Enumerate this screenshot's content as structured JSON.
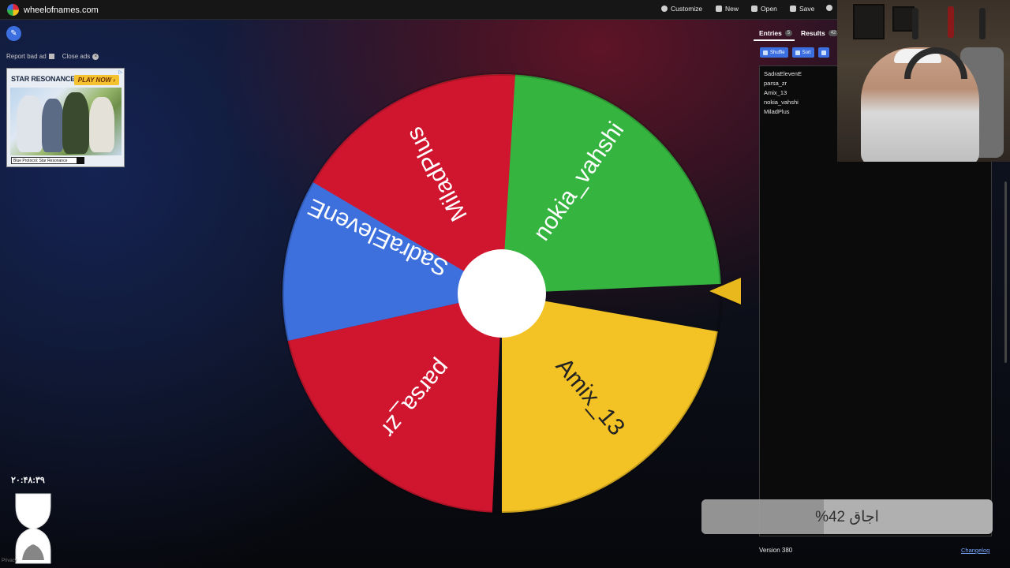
{
  "app": {
    "site_name": "wheelofnames.com",
    "menu": [
      {
        "id": "customize",
        "label": "Customize",
        "icon": "palette-icon"
      },
      {
        "id": "new",
        "label": "New",
        "icon": "file-icon"
      },
      {
        "id": "open",
        "label": "Open",
        "icon": "folder-icon"
      },
      {
        "id": "save",
        "label": "Save",
        "icon": "save-icon"
      }
    ],
    "share_icon": "share-icon"
  },
  "ads": {
    "report_label": "Report bad ad",
    "close_label": "Close ads",
    "banner": {
      "title": "STAR RESONANCE",
      "cta": "PLAY NOW ›",
      "caption": "Blue Protocol: Star Resonance"
    }
  },
  "wheel": {
    "segments": [
      {
        "label": "SadraElevenE",
        "color": "#3e70dd"
      },
      {
        "label": "parsa_zr",
        "color": "#d0162f"
      },
      {
        "label": "Amix_13",
        "color": "#f3c224"
      },
      {
        "label": "nokia_vahshi",
        "color": "#35b440"
      },
      {
        "label": "MiladPlus",
        "color": "#d0162f"
      }
    ],
    "pointer_color": "#e8b81c"
  },
  "panel": {
    "tabs": [
      {
        "label": "Entries",
        "count": "5"
      },
      {
        "label": "Results",
        "count": "42"
      }
    ],
    "toolbar": {
      "shuffle": "Shuffle",
      "sort": "Sort"
    },
    "entries": [
      "SadraElevenE",
      "parsa_zr",
      "Amix_13",
      "nokia_vahshi",
      "MiladPlus"
    ],
    "version": "Version 380",
    "changelog": "Changelog"
  },
  "overlay": {
    "progress_text": "اجاق 42%",
    "progress_fraction": 0.42,
    "clock": "۲۰:۴۸:۳۹",
    "privacy": "Privacy"
  }
}
